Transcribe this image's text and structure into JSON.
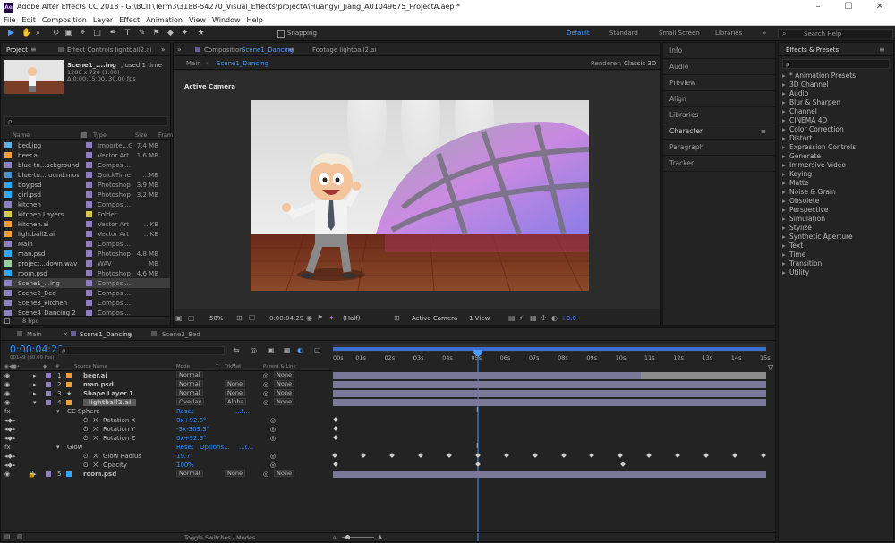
{
  "window": {
    "logo": "Ae",
    "title": "Adobe After Effects CC 2018 - G:\\BCIT\\Term3\\3188-54270_Visual_Effects\\projectA\\Huangyi_Jiang_A01049675_ProjectA.aep *",
    "minimize": "–",
    "maximize": "☐",
    "close": "✕"
  },
  "menu": [
    "File",
    "Edit",
    "Composition",
    "Layer",
    "Effect",
    "Animation",
    "View",
    "Window",
    "Help"
  ],
  "toolbar": {
    "snapping": "Snapping",
    "workspaces": [
      "Default",
      "Standard",
      "Small Screen",
      "Libraries"
    ],
    "search_placeholder": "Search Help",
    "menu_arrows": "»"
  },
  "project": {
    "tab": "Project",
    "effect_controls_tab": "Effect Controls lightball2.ai",
    "thumb_name": "Scene1_....ing",
    "thumb_used": ", used 1 time",
    "thumb_res": "1280 x 720 (1.00)",
    "thumb_dur": "Δ 0:00:15:00, 30.00 fps",
    "search_placeholder": "ρ",
    "columns": {
      "name": "Name",
      "type": "Type",
      "size": "Size",
      "frame": "Fram"
    },
    "items": [
      {
        "name": "bed.jpg",
        "type": "Importe...G",
        "size": "7.4 MB",
        "label": "#8f7fbf",
        "icon": "image-icon"
      },
      {
        "name": "beer.ai",
        "type": "Vector Art",
        "size": "1.6 MB",
        "label": "#8f7fbf",
        "icon": "ai-file-icon"
      },
      {
        "name": "blue-tu...ackground",
        "type": "Composi...",
        "size": "",
        "label": "#8f7fbf",
        "icon": "composition-icon"
      },
      {
        "name": "blue-tu...round.mov",
        "type": "QuickTime",
        "size": "...MB",
        "label": "#8f7fbf",
        "icon": "video-icon"
      },
      {
        "name": "boy.psd",
        "type": "Photoshop",
        "size": "3.9 MB",
        "label": "#8f7fbf",
        "icon": "psd-file-icon"
      },
      {
        "name": "girl.psd",
        "type": "Photoshop",
        "size": "3.2 MB",
        "label": "#8f7fbf",
        "icon": "psd-file-icon"
      },
      {
        "name": "kitchen",
        "type": "Composi...",
        "size": "",
        "label": "#8f7fbf",
        "icon": "composition-icon"
      },
      {
        "name": "kitchen Layers",
        "type": "Folder",
        "size": "",
        "label": "#d8c84a",
        "icon": "folder-icon"
      },
      {
        "name": "kitchen.ai",
        "type": "Vector Art",
        "size": "...KB",
        "label": "#8f7fbf",
        "icon": "ai-file-icon"
      },
      {
        "name": "lightball2.ai",
        "type": "Vector Art",
        "size": "...KB",
        "label": "#8f7fbf",
        "icon": "ai-file-icon"
      },
      {
        "name": "Main",
        "type": "Composi...",
        "size": "",
        "label": "#8f7fbf",
        "icon": "composition-icon"
      },
      {
        "name": "man.psd",
        "type": "Photoshop",
        "size": "4.8 MB",
        "label": "#8f7fbf",
        "icon": "psd-file-icon"
      },
      {
        "name": "project...down.wav",
        "type": "WAV",
        "size": "MB",
        "label": "#8f7fbf",
        "icon": "audio-icon"
      },
      {
        "name": "room.psd",
        "type": "Photoshop",
        "size": "4.6 MB",
        "label": "#8f7fbf",
        "icon": "psd-file-icon"
      },
      {
        "name": "Scene1_...ing",
        "type": "Composi...",
        "size": "",
        "label": "#8f7fbf",
        "icon": "composition-icon",
        "selected": true
      },
      {
        "name": "Scene2_Bed",
        "type": "Composi...",
        "size": "",
        "label": "#8f7fbf",
        "icon": "composition-icon"
      },
      {
        "name": "Scene3_kitchen",
        "type": "Composi...",
        "size": "",
        "label": "#8f7fbf",
        "icon": "composition-icon"
      },
      {
        "name": "Scene4_Dancing 2",
        "type": "Composi...",
        "size": "",
        "label": "#8f7fbf",
        "icon": "composition-icon"
      }
    ],
    "bpc": "8 bpc"
  },
  "composition": {
    "tab": "Composition",
    "tab_name": "Scene1_Dancing",
    "footage_tab": "Footage lightball2.ai",
    "crumb_main": "Main",
    "crumb_scene": "Scene1_Dancing",
    "renderer_label": "Renderer:",
    "renderer_value": "Classic 3D",
    "camera_label": "Active Camera",
    "zoom": "50%",
    "timecode": "0:00:04:29",
    "resolution": "(Half)",
    "view_camera": "Active Camera",
    "views": "1 View",
    "exposure": "+0.0"
  },
  "right_panels": {
    "info": "Info",
    "audio": "Audio",
    "preview": "Preview",
    "align": "Align",
    "libraries": "Libraries",
    "character": "Character",
    "paragraph": "Paragraph",
    "tracker": "Tracker"
  },
  "effects": {
    "title": "Effects & Presets",
    "search_placeholder": "ρ",
    "items": [
      "* Animation Presets",
      "3D Channel",
      "Audio",
      "Blur & Sharpen",
      "Channel",
      "CINEMA 4D",
      "Color Correction",
      "Distort",
      "Expression Controls",
      "Generate",
      "Immersive Video",
      "Keying",
      "Matte",
      "Noise & Grain",
      "Obsolete",
      "Perspective",
      "Simulation",
      "Stylize",
      "Synthetic Aperture",
      "Text",
      "Time",
      "Transition",
      "Utility"
    ]
  },
  "timeline": {
    "tabs": [
      "Main",
      "Scene1_Dancing",
      "Scene2_Bed"
    ],
    "timecode": "0:00:04:29",
    "frame_info": "00149 (30.00 fps)",
    "search_placeholder": "ρ",
    "headers": {
      "source": "Source Name",
      "mode": "Mode",
      "t": "T",
      "trkmat": "TrkMat",
      "parent": "Parent & Link",
      "num": "#"
    },
    "ruler": [
      "00s",
      "01s",
      "02s",
      "03s",
      "04s",
      "05s",
      "06s",
      "07s",
      "08s",
      "09s",
      "10s",
      "11s",
      "12s",
      "13s",
      "14s",
      "15s"
    ],
    "layers": [
      {
        "num": "1",
        "name": "beer.ai",
        "mode": "Normal",
        "trkmat": "",
        "parent": "None",
        "color": "#8f7fbf"
      },
      {
        "num": "2",
        "name": "man.psd",
        "mode": "Normal",
        "trkmat": "None",
        "parent": "None",
        "color": "#8f7fbf"
      },
      {
        "num": "3",
        "name": "Shape Layer 1",
        "mode": "Normal",
        "trkmat": "None",
        "parent": "None",
        "color": "#8f7fbf"
      },
      {
        "num": "4",
        "name": "lightball2.ai",
        "mode": "Overlay",
        "trkmat": "Alpha",
        "parent": "None",
        "color": "#8f7fbf"
      }
    ],
    "cc_sphere": {
      "name": "CC Sphere",
      "reset": "Reset",
      "dots": "...t...",
      "props": [
        {
          "name": "Rotation X",
          "value": "0x+92.6°"
        },
        {
          "name": "Rotation Y",
          "value": "-3x-309.3°"
        },
        {
          "name": "Rotation Z",
          "value": "0x+92.6°"
        }
      ]
    },
    "glow": {
      "name": "Glow",
      "reset": "Reset",
      "options": "Options...",
      "dots": "...t...",
      "props": [
        {
          "name": "Glow Radius",
          "value": "19.7"
        },
        {
          "name": "Opacity",
          "value": "100",
          "unit": "%"
        }
      ]
    },
    "layer5": {
      "num": "5",
      "name": "room.psd",
      "mode": "Normal",
      "trkmat": "None",
      "parent": "None"
    },
    "toggle": "Toggle Switches / Modes"
  }
}
